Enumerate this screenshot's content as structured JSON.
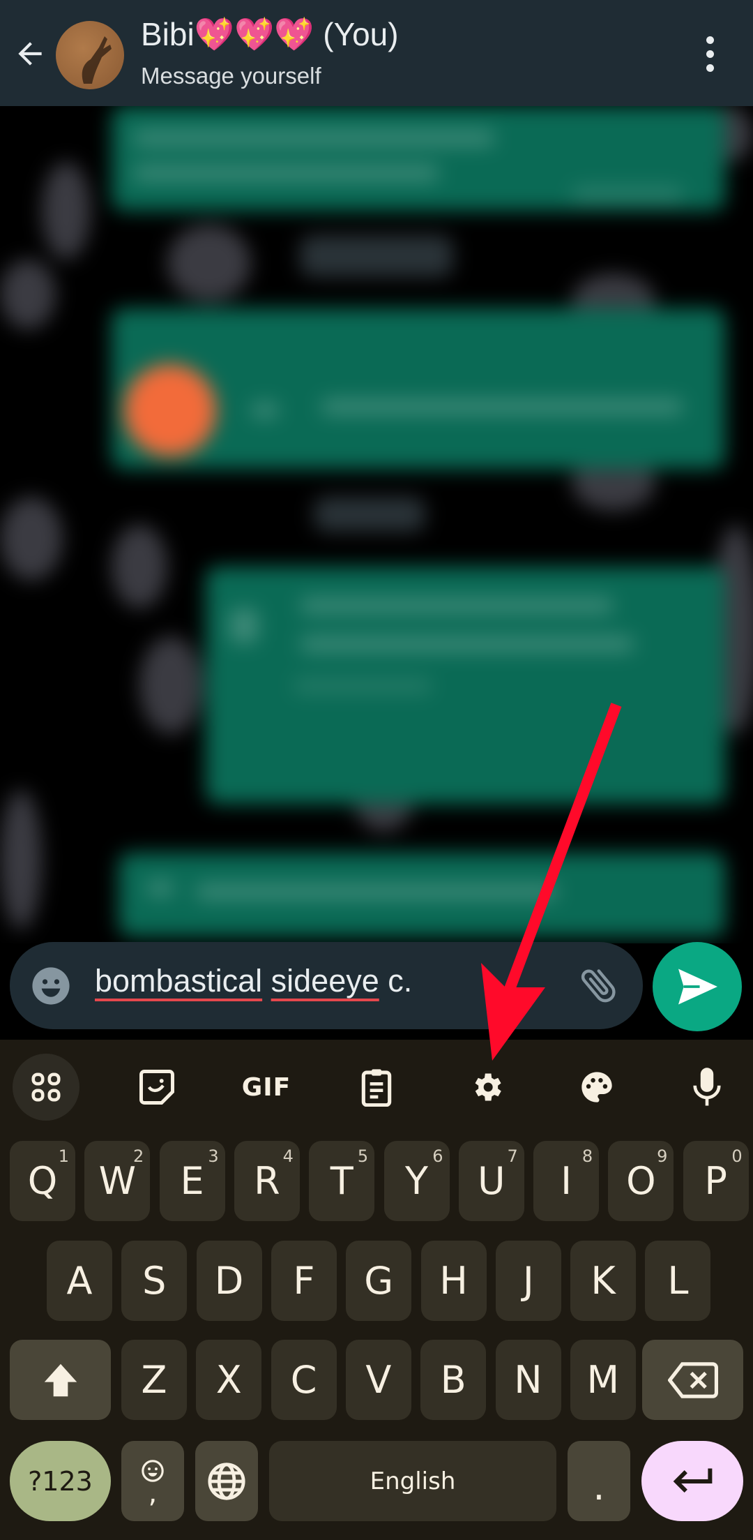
{
  "header": {
    "title": "Bibi💖💖💖 (You)",
    "subtitle": "Message yourself",
    "back_icon": "arrow-left-icon",
    "menu_icon": "more-vert-icon"
  },
  "composer": {
    "words": [
      {
        "text": "bombastical",
        "misspelled": true
      },
      {
        "text": " ",
        "misspelled": false
      },
      {
        "text": "sideeye",
        "misspelled": true
      },
      {
        "text": " c.",
        "misspelled": false
      }
    ],
    "emoji_icon": "smiley-icon",
    "attach_icon": "paperclip-icon",
    "send_icon": "send-icon"
  },
  "keyboard": {
    "toolbar": [
      {
        "name": "apps-grid-icon"
      },
      {
        "name": "sticker-icon"
      },
      {
        "name": "gif-button",
        "label": "GIF"
      },
      {
        "name": "clipboard-icon"
      },
      {
        "name": "settings-gear-icon"
      },
      {
        "name": "palette-icon"
      },
      {
        "name": "microphone-icon"
      }
    ],
    "row1": [
      {
        "k": "Q",
        "n": "1"
      },
      {
        "k": "W",
        "n": "2"
      },
      {
        "k": "E",
        "n": "3"
      },
      {
        "k": "R",
        "n": "4"
      },
      {
        "k": "T",
        "n": "5"
      },
      {
        "k": "Y",
        "n": "6"
      },
      {
        "k": "U",
        "n": "7"
      },
      {
        "k": "I",
        "n": "8"
      },
      {
        "k": "O",
        "n": "9"
      },
      {
        "k": "P",
        "n": "0"
      }
    ],
    "row2": [
      "A",
      "S",
      "D",
      "F",
      "G",
      "H",
      "J",
      "K",
      "L"
    ],
    "row3": [
      "Z",
      "X",
      "C",
      "V",
      "B",
      "N",
      "M"
    ],
    "bottom": {
      "symbols": "?123",
      "comma": ",",
      "space": "English",
      "period": "."
    }
  },
  "annotation": {
    "color": "#ff0a2a",
    "points_to": "settings-gear-icon"
  },
  "colors": {
    "header_bg": "#1f2c34",
    "bubble": "#0a6a55",
    "send": "#0aa883",
    "keyboard_bg": "#1e1a12",
    "key": "#343025",
    "symbols_key": "#a9b786",
    "enter_key": "#f8d8fc"
  }
}
